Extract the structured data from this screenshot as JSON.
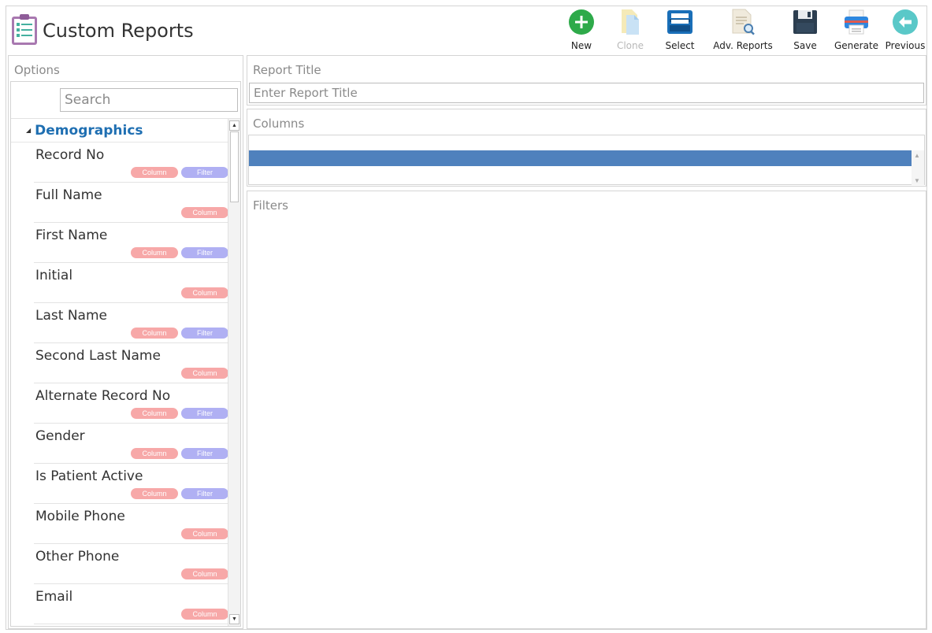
{
  "header": {
    "title": "Custom Reports",
    "app_icon": "clipboard-list-icon"
  },
  "toolbar": {
    "buttons": [
      {
        "label": "New",
        "icon": "plus-circle-icon",
        "enabled": true
      },
      {
        "label": "Clone",
        "icon": "clone-document-icon",
        "enabled": false
      },
      {
        "label": "Select",
        "icon": "inbox-tray-icon",
        "enabled": true
      },
      {
        "label": "Adv. Reports",
        "icon": "document-search-icon",
        "enabled": true
      },
      {
        "label": "Save",
        "icon": "floppy-disk-icon",
        "enabled": true
      },
      {
        "label": "Generate",
        "icon": "printer-icon",
        "enabled": true
      },
      {
        "label": "Previous",
        "icon": "arrow-left-circle-icon",
        "enabled": true
      }
    ]
  },
  "options": {
    "title": "Options",
    "search_placeholder": "Search",
    "group": "Demographics",
    "column_tag": "Column",
    "filter_tag": "Filter",
    "fields": [
      {
        "name": "Record No",
        "column": true,
        "filter": true
      },
      {
        "name": "Full Name",
        "column": true,
        "filter": false
      },
      {
        "name": "First Name",
        "column": true,
        "filter": true
      },
      {
        "name": "Initial",
        "column": true,
        "filter": false
      },
      {
        "name": "Last Name",
        "column": true,
        "filter": true
      },
      {
        "name": "Second Last Name",
        "column": true,
        "filter": false
      },
      {
        "name": "Alternate Record No",
        "column": true,
        "filter": true
      },
      {
        "name": "Gender",
        "column": true,
        "filter": true
      },
      {
        "name": "Is Patient Active",
        "column": true,
        "filter": true
      },
      {
        "name": "Mobile Phone",
        "column": true,
        "filter": false
      },
      {
        "name": "Other Phone",
        "column": true,
        "filter": false
      },
      {
        "name": "Email",
        "column": true,
        "filter": false
      }
    ]
  },
  "report_title": {
    "title": "Report Title",
    "placeholder": "Enter Report Title"
  },
  "columns": {
    "title": "Columns"
  },
  "filters": {
    "title": "Filters"
  },
  "colors": {
    "group_blue": "#1f6fb2",
    "selected_row": "#4f81bd",
    "column_tag": "#f7a8a8",
    "filter_tag": "#b0b0f3"
  }
}
